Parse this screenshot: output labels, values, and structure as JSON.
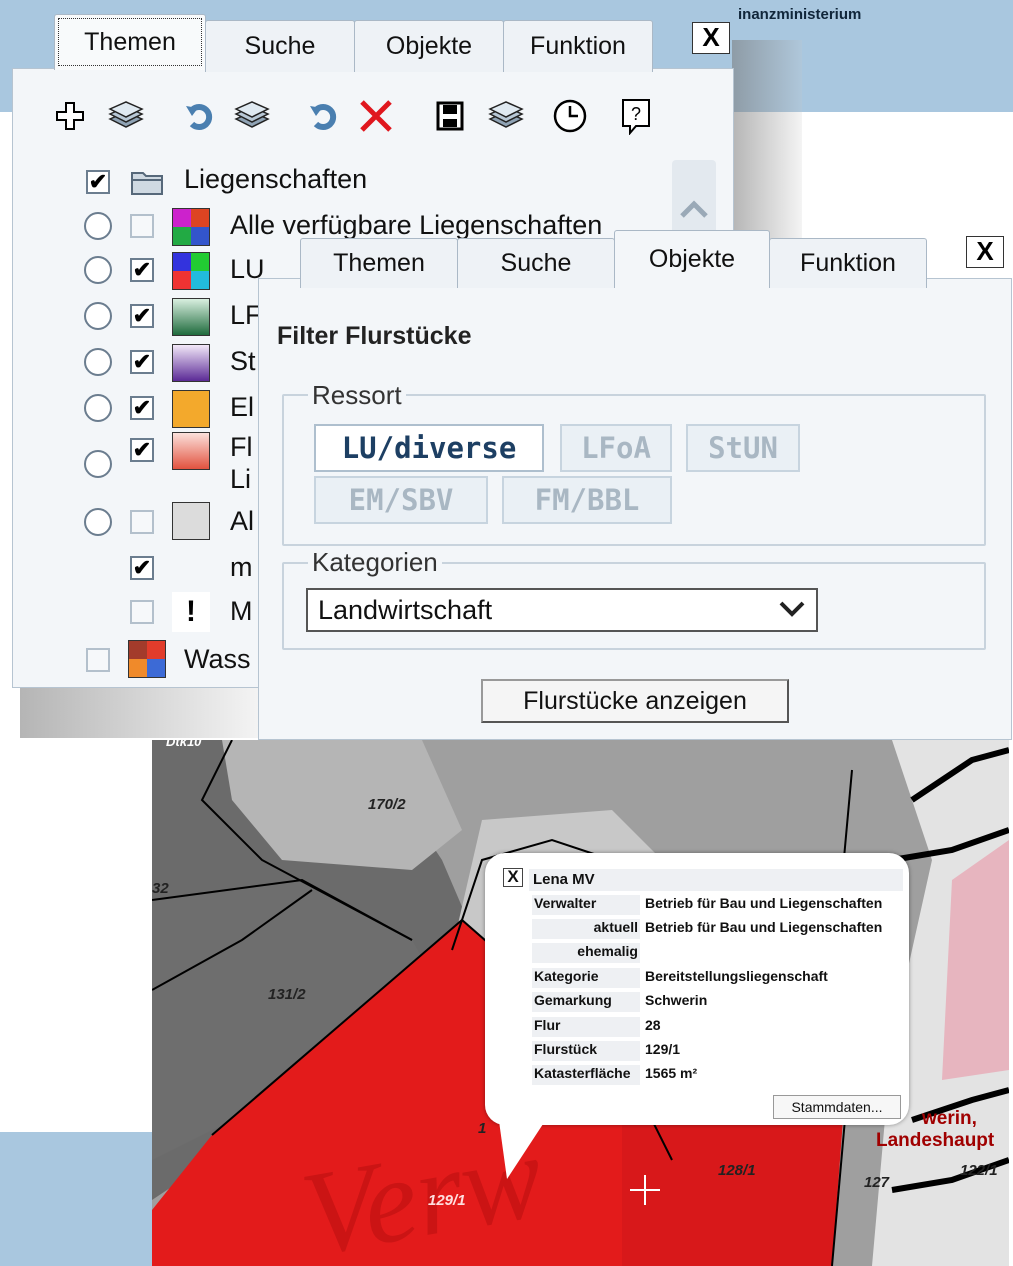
{
  "header": {
    "ministry_text": "inanzministerium"
  },
  "themen_panel": {
    "tabs": [
      {
        "label": "Themen"
      },
      {
        "label": "Suche"
      },
      {
        "label": "Objekte"
      },
      {
        "label": "Funktion"
      }
    ],
    "close_label": "X",
    "toolbar_icons": [
      "add-layer-icon",
      "layers-icon",
      "refresh-icon",
      "layers-icon",
      "refresh-icon",
      "delete-icon",
      "save-icon",
      "layers-icon",
      "clock-icon",
      "help-icon"
    ],
    "tree": {
      "folder_label": "Liegenschaften",
      "items": [
        {
          "label": "Alle verfügbare Liegenschaften",
          "checked": false,
          "radio": true
        },
        {
          "label": "LU",
          "checked": true,
          "radio": true
        },
        {
          "label": "LF",
          "checked": true,
          "radio": true
        },
        {
          "label": "St",
          "checked": true,
          "radio": true
        },
        {
          "label": "El",
          "checked": true,
          "radio": true
        },
        {
          "label": "Fl",
          "label2": "Li",
          "checked": true,
          "radio": true
        },
        {
          "label": "Al",
          "checked": false,
          "radio": true
        },
        {
          "label": "m",
          "checked": true,
          "radio": false
        },
        {
          "label": "M",
          "checked": false,
          "radio": false
        },
        {
          "label": "Wass",
          "checked": false,
          "radio": false
        }
      ]
    }
  },
  "objekte_panel": {
    "tabs": [
      {
        "label": "Themen"
      },
      {
        "label": "Suche"
      },
      {
        "label": "Objekte"
      },
      {
        "label": "Funktion"
      }
    ],
    "close_label": "X",
    "title": "Filter Flurstücke",
    "ressort": {
      "legend": "Ressort",
      "buttons": [
        "LU/diverse",
        "LFoA",
        "StUN",
        "EM/SBV",
        "FM/BBL"
      ],
      "selected": "LU/diverse"
    },
    "kategorien": {
      "legend": "Kategorien",
      "selected": "Landwirtschaft"
    },
    "submit_label": "Flurstücke anzeigen"
  },
  "map": {
    "top_label": "Dtk10",
    "parcels": [
      "170/2",
      "32",
      "131/2",
      "129/1",
      "128/1",
      "127",
      "122/1",
      "1"
    ],
    "place_label_1": "werin,",
    "place_label_2": "Landeshaupt",
    "watermark": "Verw"
  },
  "popup": {
    "close_label": "X",
    "title": "Lena MV",
    "rows": [
      {
        "key": "Verwalter",
        "value": "Betrieb für Bau und Liegenschaften"
      },
      {
        "key": "aktuell",
        "value": "Betrieb für Bau und Liegenschaften"
      },
      {
        "key": "ehemalig",
        "value": ""
      },
      {
        "key": "Kategorie",
        "value": "Bereitstellungsliegenschaft"
      },
      {
        "key": "Gemarkung",
        "value": "Schwerin"
      },
      {
        "key": "Flur",
        "value": "28"
      },
      {
        "key": "Flurstück",
        "value": "129/1"
      },
      {
        "key": "Katasterfläche",
        "value": "1565 m²"
      }
    ],
    "button_label": "Stammdaten..."
  },
  "colors": {
    "selected_parcel": "#e31b1b",
    "band": "#a9c7df",
    "ressort_selected_text": "#1d3f63"
  }
}
